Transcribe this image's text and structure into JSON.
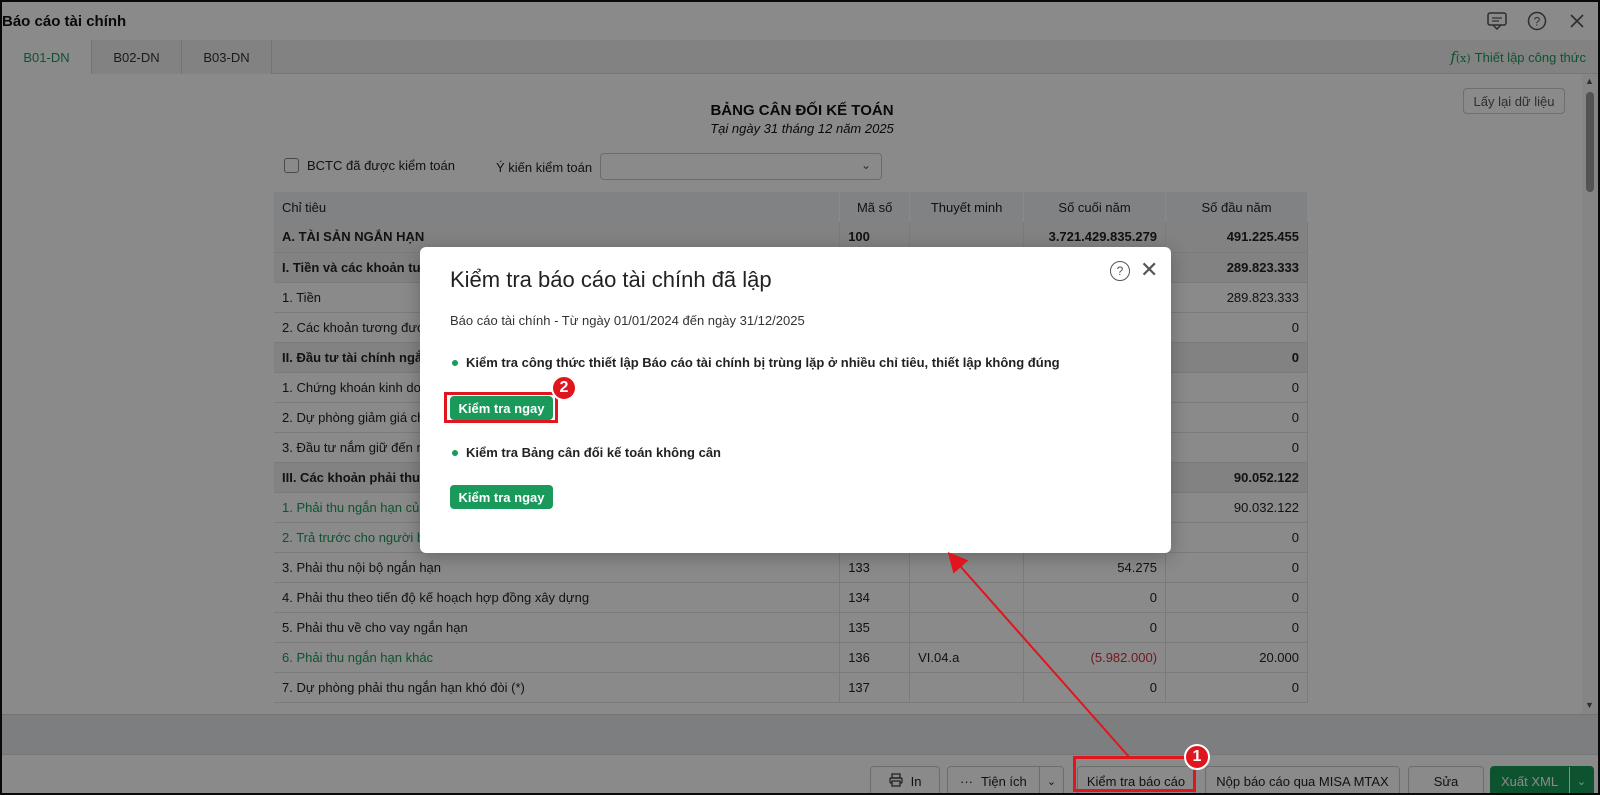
{
  "window": {
    "title": "Báo cáo tài chính"
  },
  "tabs": [
    "B01-DN",
    "B02-DN",
    "B03-DN"
  ],
  "formula_link": "Thiết lập công thức",
  "reload_button": "Lấy lại dữ liệu",
  "report": {
    "title": "BẢNG CÂN ĐỐI KẾ TOÁN",
    "subtitle": "Tại ngày 31 tháng 12 năm 2025",
    "audited_checkbox": "BCTC đã được kiểm toán",
    "audit_opinion_label": "Ý kiến kiểm toán",
    "audit_opinion_value": ""
  },
  "table": {
    "headers": [
      "Chỉ tiêu",
      "Mã số",
      "Thuyết minh",
      "Số cuối năm",
      "Số đầu năm"
    ],
    "rows": [
      {
        "label": "A. TÀI SẢN NGẮN HẠN",
        "code": "100",
        "note": "",
        "end": "3.721.429.835.279",
        "start": "491.225.455"
      },
      {
        "label": "I. Tiền và các khoản tươ",
        "code": "",
        "note": "",
        "end": "",
        "start": "289.823.333"
      },
      {
        "label": "1. Tiền",
        "code": "",
        "note": "",
        "end": "",
        "start": "289.823.333"
      },
      {
        "label": "2. Các khoản tương đươ",
        "code": "",
        "note": "",
        "end": "",
        "start": "0"
      },
      {
        "label": "II. Đầu tư tài chính ngắn",
        "code": "",
        "note": "",
        "end": "",
        "start": "0"
      },
      {
        "label": "1. Chứng khoán kinh doa",
        "code": "",
        "note": "",
        "end": "",
        "start": "0"
      },
      {
        "label": "2. Dự phòng giảm giá chu",
        "code": "",
        "note": "",
        "end": "",
        "start": "0"
      },
      {
        "label": "3. Đầu tư nắm giữ đến ng",
        "code": "",
        "note": "",
        "end": "",
        "start": "0"
      },
      {
        "label": "III. Các khoản phải thu n",
        "code": "",
        "note": "",
        "end": "",
        "start": "90.052.122"
      },
      {
        "label": "1. Phải thu ngắn hạn của",
        "code": "",
        "note": "",
        "end": "",
        "start": "90.032.122"
      },
      {
        "label": "2. Trả trước cho người bá",
        "code": "",
        "note": "",
        "end": "",
        "start": "0"
      },
      {
        "label": "3. Phải thu nội bộ ngắn hạn",
        "code": "133",
        "note": "",
        "end": "54.275",
        "start": "0"
      },
      {
        "label": "4. Phải thu theo tiến độ kế hoạch hợp đồng xây dựng",
        "code": "134",
        "note": "",
        "end": "0",
        "start": "0"
      },
      {
        "label": "5. Phải thu về cho vay ngắn hạn",
        "code": "135",
        "note": "",
        "end": "0",
        "start": "0"
      },
      {
        "label": "6. Phải thu ngắn hạn khác",
        "code": "136",
        "note": "VI.04.a",
        "end": "(5.982.000)",
        "start": "20.000"
      },
      {
        "label": "7. Dự phòng phải thu ngắn hạn khó đòi (*)",
        "code": "137",
        "note": "",
        "end": "0",
        "start": "0"
      }
    ]
  },
  "bottom_buttons": {
    "print": "In",
    "utilities": "Tiện ích",
    "check_report": "Kiểm tra báo cáo",
    "submit": "Nộp báo cáo qua MISA MTAX",
    "edit": "Sửa",
    "export_xml": "Xuất XML"
  },
  "dialog": {
    "title": "Kiểm tra báo cáo tài chính đã lập",
    "subtitle": "Báo cáo tài chính - Từ ngày 01/01/2024 đến ngày 31/12/2025",
    "check1": "Kiểm tra công thức thiết lập Báo cáo tài chính bị trùng lặp ở nhiều chỉ tiêu, thiết lập không đúng",
    "check2": "Kiểm tra Bảng cân đối kế toán không cân",
    "run_label": "Kiểm tra ngay"
  },
  "annotations": {
    "step1": "1",
    "step2": "2",
    "highlight_color": "#e0161e"
  },
  "colors": {
    "accent": "#1a9a5a",
    "negative": "#d0303a"
  }
}
